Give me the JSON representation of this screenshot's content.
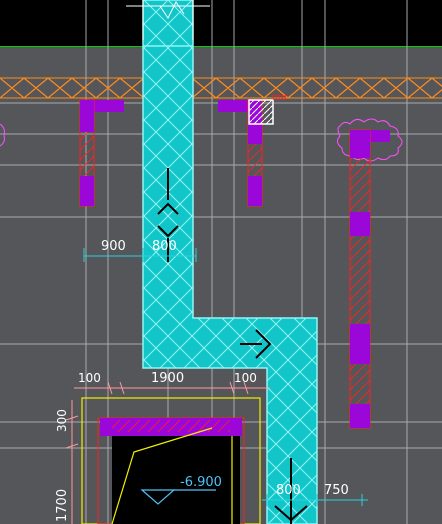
{
  "drawing": {
    "colors": {
      "canvas": "#555659",
      "top_strip": "#000000",
      "grid_line": "#a9a9b0",
      "wall_fill": "#12c5c9",
      "wall_hatch": "#8ff5f5",
      "column_fill": "#9a07d8",
      "red_line": "#ff2020",
      "orange_pattern": "#ff8a1c",
      "yellow_line": "#f0f000",
      "green_line": "#00d000",
      "dimension_line": "#27d2da",
      "magenta_cloud": "#ff50ff"
    },
    "dimensions": {
      "d900": "900",
      "d800_top": "800",
      "d100_left": "100",
      "d1900": "1900",
      "d100_right": "100",
      "d300": "300",
      "d1700": "1700",
      "d800_bottom": "800",
      "d750": "750"
    },
    "elevation_label": "-6.900",
    "marker_tag": "ttttt"
  }
}
